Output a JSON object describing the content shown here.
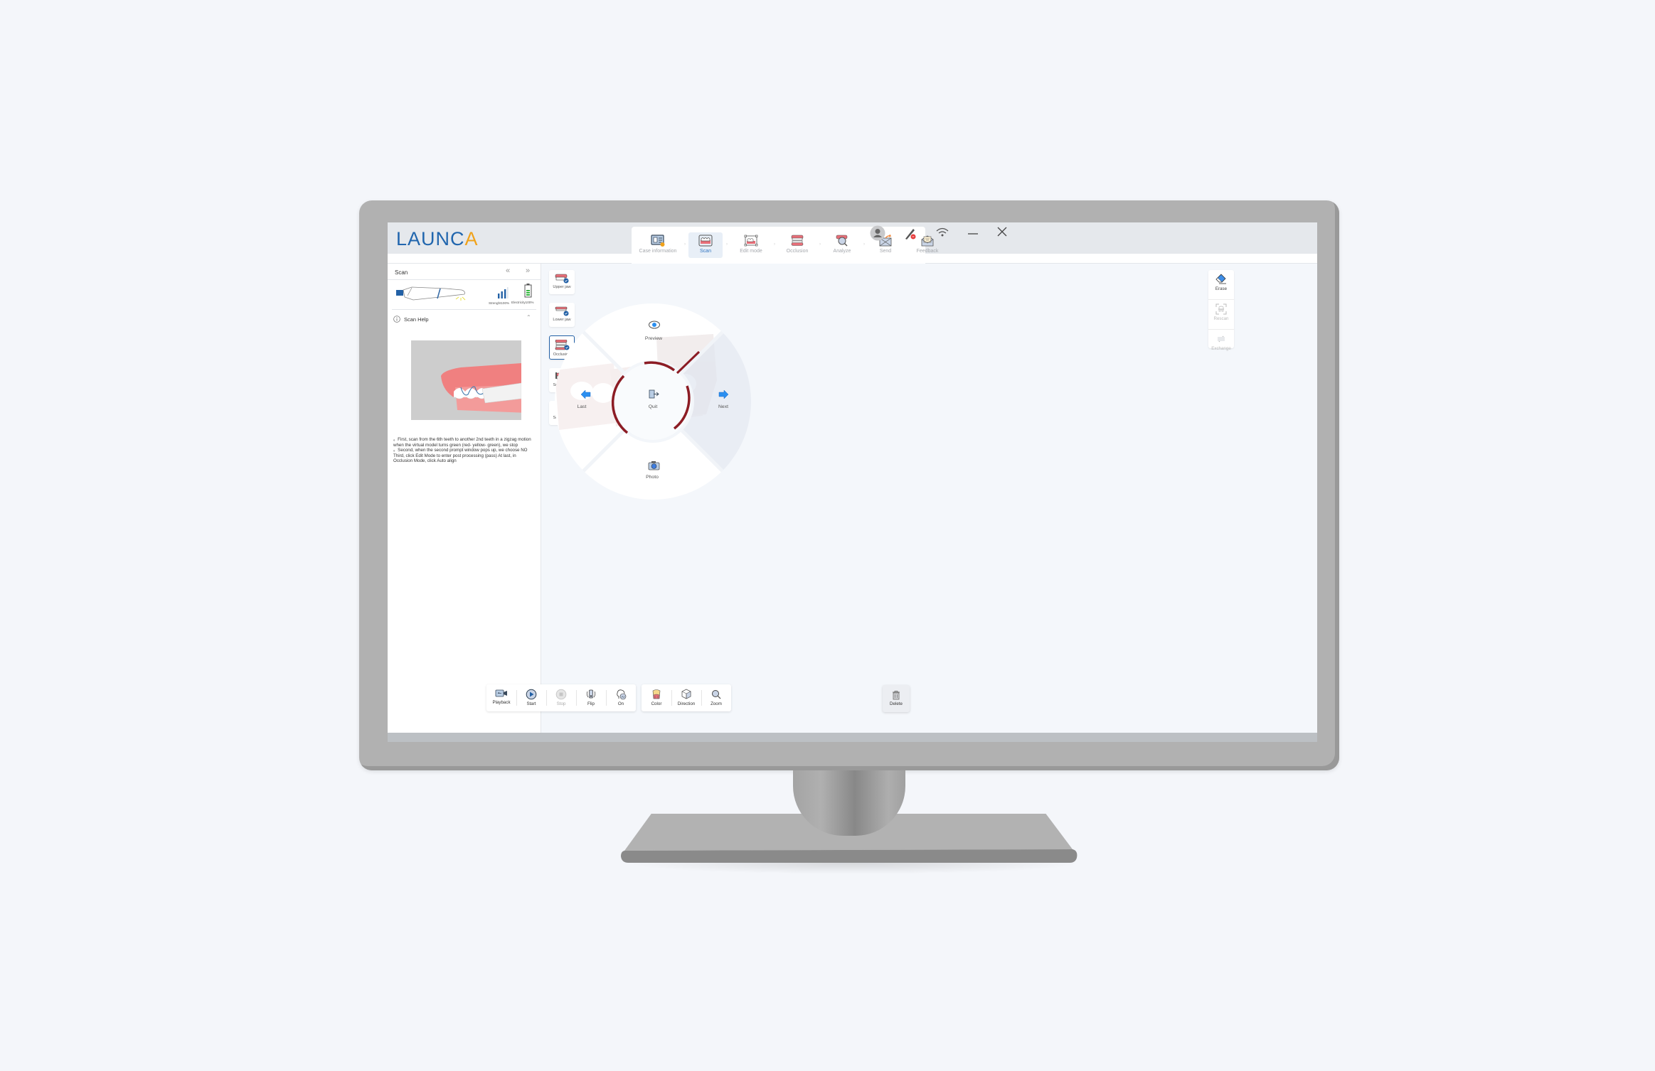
{
  "app": {
    "logo_main": "LAUNC",
    "logo_accent": "A"
  },
  "steps": [
    {
      "label": "Case information",
      "icon": "case-info-icon",
      "done": true
    },
    {
      "label": "Scan",
      "icon": "scan-step-icon",
      "active": true
    },
    {
      "label": "Edit mode",
      "icon": "edit-mode-icon"
    },
    {
      "label": "Occlusion",
      "icon": "occlusion-step-icon"
    },
    {
      "label": "Analyze",
      "icon": "analyze-icon"
    },
    {
      "label": "Send",
      "icon": "send-icon"
    },
    {
      "label": "Feedback",
      "icon": "feedback-icon"
    }
  ],
  "header_icons": [
    "user-avatar-icon",
    "scanner-pen-icon",
    "wifi-icon",
    "minimize-icon",
    "close-icon"
  ],
  "left_panel": {
    "title": "Scan",
    "collapse_icon": "double-chevron-left-icon",
    "expand_icon": "double-chevron-right-icon",
    "strength_label": "Strenght100%",
    "electricity_label": "Electricity100%",
    "strength_level": 1.0,
    "battery_level": 1.0,
    "help_title": "Scan Help",
    "help_lines": [
      "。First, scan from the 6th teeth to another 2nd teeth in a zigzag motion when the virtual model turns green (red- yellow- green), we stop",
      "。Second, when the second prompt window pops up, we choose NO Third, click Edit Mode to enter post processing (pass) At last, in Occlusion Mode, click Auto align"
    ]
  },
  "tools": [
    {
      "label": "Upper jaw",
      "done": true
    },
    {
      "label": "Lower jaw",
      "done": true
    },
    {
      "label": "Occlusion",
      "done": true,
      "active": true
    },
    {
      "label": "Scanbody"
    },
    {
      "label": "Scanbody"
    }
  ],
  "right_tools": [
    {
      "label": "Erase",
      "enabled": true
    },
    {
      "label": "Rescan",
      "enabled": false
    },
    {
      "label": "Exchange",
      "enabled": false
    }
  ],
  "radial_menu": {
    "top": "Preview",
    "left": "Last",
    "center": "Quit",
    "right": "Next",
    "bottom": "Photo"
  },
  "toolbar_group1": [
    {
      "label": "Playback",
      "enabled": true
    },
    {
      "label": "Start",
      "enabled": true
    },
    {
      "label": "Stop",
      "enabled": false
    },
    {
      "label": "Flip",
      "enabled": true
    },
    {
      "label": "On",
      "enabled": true
    }
  ],
  "toolbar_group2": [
    {
      "label": "Color"
    },
    {
      "label": "Direction"
    },
    {
      "label": "Zoom"
    }
  ],
  "delete_label": "Delete",
  "colors": {
    "brand_blue": "#2166ae",
    "brand_orange": "#f0a21a",
    "active_blue": "#2361a6",
    "arrow_blue": "#2b8ff0",
    "gum_pink": "#e86e78",
    "scan_ring": "#8c1c24"
  }
}
